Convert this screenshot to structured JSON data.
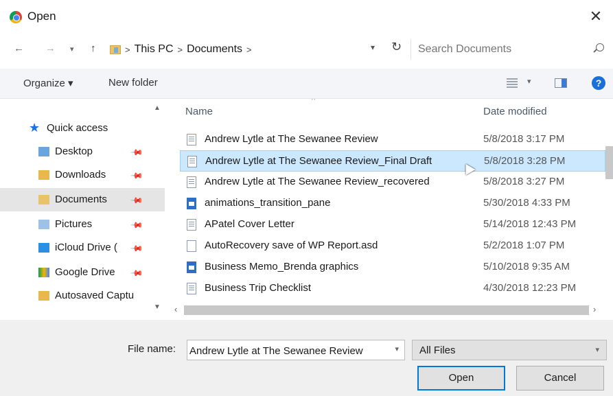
{
  "window": {
    "title": "Open",
    "close_glyph": "✕"
  },
  "address": {
    "path": [
      "This PC",
      "Documents"
    ],
    "search_placeholder": "Search Documents"
  },
  "toolbar": {
    "organize": "Organize ▾",
    "new_folder": "New folder",
    "help": "?"
  },
  "sidebar": {
    "items": [
      {
        "label": "Quick access",
        "icon": "star-icon"
      },
      {
        "label": "Desktop",
        "icon": "folder-icon"
      },
      {
        "label": "Downloads",
        "icon": "downloads-icon"
      },
      {
        "label": "Documents",
        "icon": "documents-icon",
        "selected": true
      },
      {
        "label": "Pictures",
        "icon": "pictures-icon"
      },
      {
        "label": "iCloud Drive (",
        "icon": "cloud-icon"
      },
      {
        "label": "Google Drive",
        "icon": "google-drive-icon"
      },
      {
        "label": "Autosaved Captu",
        "icon": "folder-icon"
      }
    ]
  },
  "list": {
    "columns": {
      "name": "Name",
      "date": "Date modified"
    },
    "rows": [
      {
        "name": "Andrew Lytle at The Sewanee Review",
        "date": "5/8/2018 3:17 PM",
        "icon": "doc"
      },
      {
        "name": "Andrew Lytle at The Sewanee Review_Final Draft",
        "date": "5/8/2018 3:28 PM",
        "icon": "doc",
        "selected": true
      },
      {
        "name": "Andrew Lytle at The Sewanee Review_recovered",
        "date": "5/8/2018 3:27 PM",
        "icon": "doc"
      },
      {
        "name": "animations_transition_pane",
        "date": "5/30/2018 4:33 PM",
        "icon": "img"
      },
      {
        "name": "APatel Cover Letter",
        "date": "5/14/2018 12:43 PM",
        "icon": "doc"
      },
      {
        "name": "AutoRecovery save of WP Report.asd",
        "date": "5/2/2018 1:07 PM",
        "icon": "blank"
      },
      {
        "name": "Business Memo_Brenda graphics",
        "date": "5/10/2018 9:35 AM",
        "icon": "img"
      },
      {
        "name": "Business Trip Checklist",
        "date": "4/30/2018 12:23 PM",
        "icon": "doc"
      }
    ]
  },
  "bottom": {
    "file_name_label": "File name:",
    "file_name_value": "Andrew Lytle at The Sewanee Review",
    "file_type": "All Files",
    "open": "Open",
    "cancel": "Cancel"
  }
}
